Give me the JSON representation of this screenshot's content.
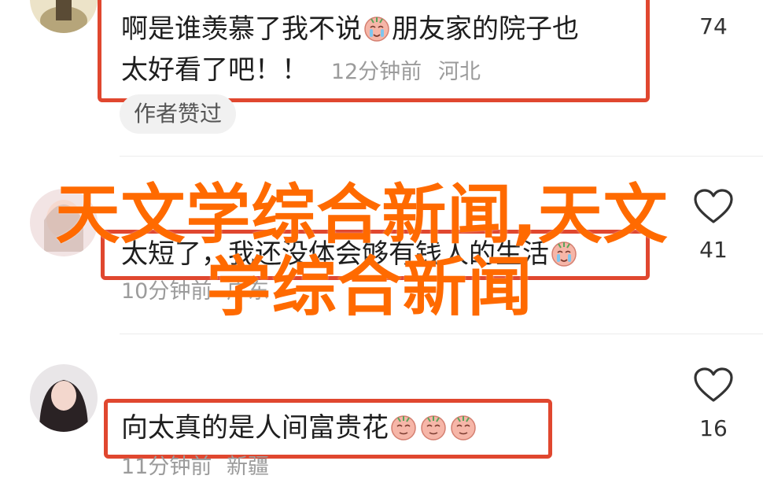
{
  "comments": [
    {
      "line1": "啊是谁羡慕了我不说",
      "line1_after": "朋友家的院子也",
      "line2": "太好看了吧！！",
      "time": "12分钟前",
      "location": "河北",
      "likes": "74",
      "tag": "作者赞过"
    },
    {
      "text": "太短了，我还没体会够有钱人的生活",
      "time": "10分钟前",
      "location": "广东",
      "likes": "41"
    },
    {
      "text": "向太真的是人间富贵花",
      "time": "11分钟前",
      "location": "新疆",
      "likes": "16"
    }
  ],
  "watermark": {
    "line1": "天文学综合新闻,天文",
    "line2": "学综合新闻"
  },
  "colors": {
    "highlight_border": "#e0472f",
    "watermark": "#ff6a00",
    "meta_text": "#9b9b9b"
  },
  "icons": {
    "like": "heart-outline-icon",
    "emoji": "crying-face-emoji"
  }
}
